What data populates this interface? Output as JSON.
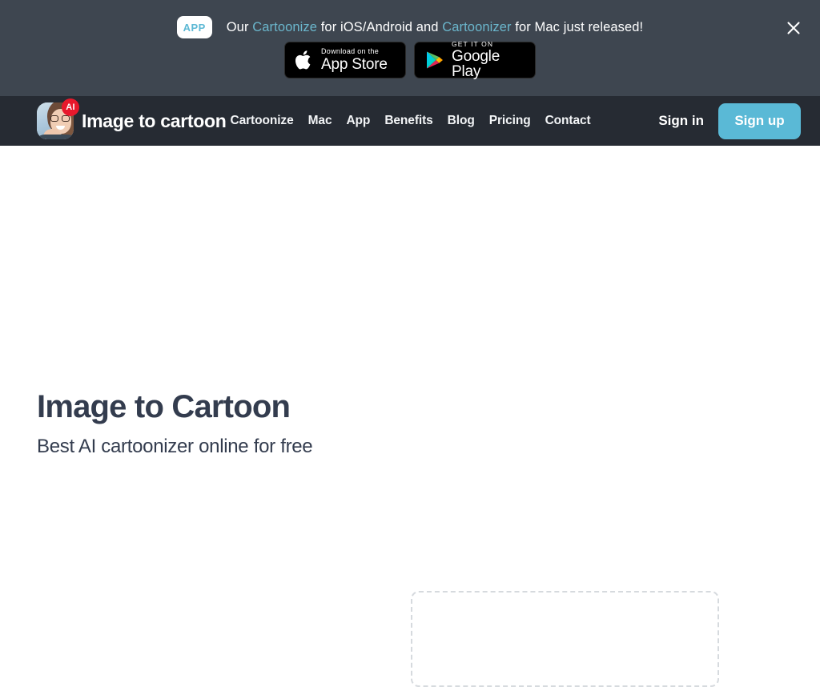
{
  "banner": {
    "badge_label": "APP",
    "text_parts": [
      {
        "t": "Our ",
        "link": false
      },
      {
        "t": "Cartoonize",
        "link": true
      },
      {
        "t": " for iOS/Android and ",
        "link": false
      },
      {
        "t": "Cartoonizer",
        "link": true
      },
      {
        "t": " for Mac just released!",
        "link": false
      }
    ],
    "text_plain": "Our Cartoonize for iOS/Android and Cartoonizer for Mac just released!",
    "close_icon": "close-icon",
    "background_color": "#3e4650",
    "link_color": "#6bb7cd",
    "badge_text_color": "#5cb8d4",
    "app_store": {
      "small_label": "Download on the",
      "big_label": "App Store",
      "icon": "apple-logo-icon"
    },
    "google_play": {
      "small_label": "GET IT ON",
      "big_label": "Google Play",
      "icon": "google-play-icon"
    }
  },
  "navbar": {
    "background_color": "#262b33",
    "logo": {
      "icon": "avatar-logo-icon",
      "badge": "AI",
      "badge_color": "#e8192c"
    },
    "brand_title": "Image to cartoon",
    "links": [
      {
        "label": "Cartoonize"
      },
      {
        "label": "Mac"
      },
      {
        "label": "App"
      },
      {
        "label": "Benefits"
      },
      {
        "label": "Blog"
      },
      {
        "label": "Pricing"
      },
      {
        "label": "Contact"
      }
    ],
    "sign_in_label": "Sign in",
    "sign_up_label": "Sign up",
    "sign_up_color": "#5ab9d6"
  },
  "hero": {
    "title": "Image to Cartoon",
    "subtitle": "Best AI cartoonizer online for free",
    "text_color": "#333c4e",
    "dropzone": {
      "name": "upload-dropzone",
      "border_color": "#d6dade"
    }
  }
}
